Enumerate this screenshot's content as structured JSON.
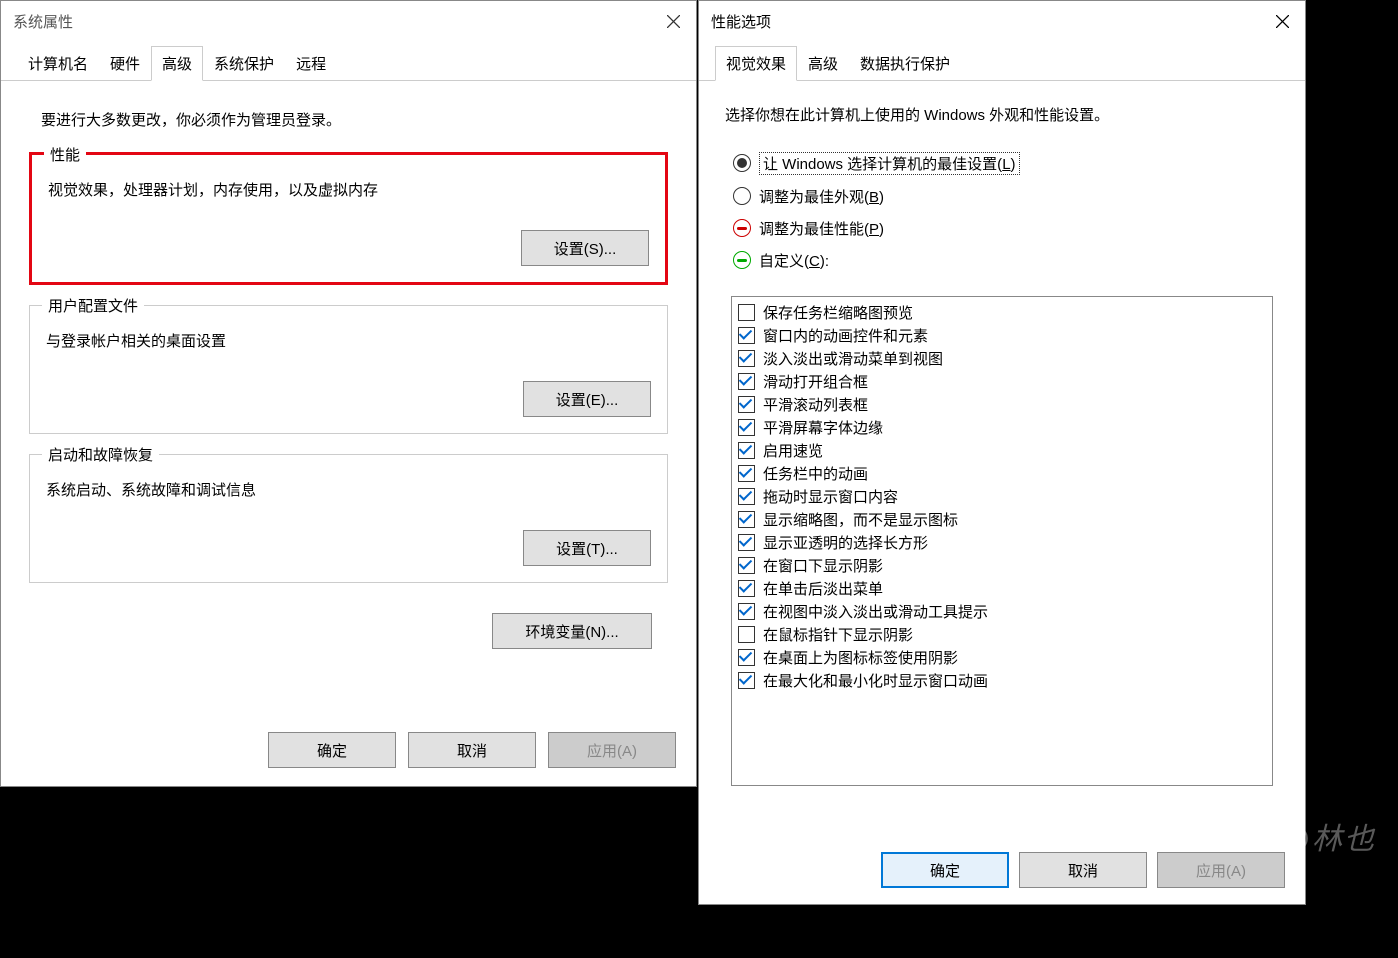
{
  "sysprop": {
    "title": "系统属性",
    "tabs": [
      "计算机名",
      "硬件",
      "高级",
      "系统保护",
      "远程"
    ],
    "active_tab": 2,
    "admin_note": "要进行大多数更改，你必须作为管理员登录。",
    "groups": {
      "perf": {
        "title": "性能",
        "desc": "视觉效果，处理器计划，内存使用，以及虚拟内存",
        "btn": "设置(S)..."
      },
      "user": {
        "title": "用户配置文件",
        "desc": "与登录帐户相关的桌面设置",
        "btn": "设置(E)..."
      },
      "boot": {
        "title": "启动和故障恢复",
        "desc": "系统启动、系统故障和调试信息",
        "btn": "设置(T)..."
      }
    },
    "envvar_btn": "环境变量(N)...",
    "footer": {
      "ok": "确定",
      "cancel": "取消",
      "apply": "应用(A)"
    }
  },
  "perfopt": {
    "title": "性能选项",
    "tabs": [
      "视觉效果",
      "高级",
      "数据执行保护"
    ],
    "active_tab": 0,
    "desc": "选择你想在此计算机上使用的 Windows 外观和性能设置。",
    "radios": [
      {
        "pre": "让 Windows 选择计算机的最佳设置(",
        "hot": "L",
        "post": ")",
        "state": "selected",
        "dotted": true
      },
      {
        "pre": "调整为最佳外观(",
        "hot": "B",
        "post": ")",
        "state": ""
      },
      {
        "pre": "调整为最佳性能(",
        "hot": "P",
        "post": ")",
        "state": "red"
      },
      {
        "pre": "自定义(",
        "hot": "C",
        "post": "):",
        "state": "green"
      }
    ],
    "checks": [
      {
        "on": false,
        "label": "保存任务栏缩略图预览"
      },
      {
        "on": true,
        "label": "窗口内的动画控件和元素"
      },
      {
        "on": true,
        "label": "淡入淡出或滑动菜单到视图"
      },
      {
        "on": true,
        "label": "滑动打开组合框"
      },
      {
        "on": true,
        "label": "平滑滚动列表框"
      },
      {
        "on": true,
        "label": "平滑屏幕字体边缘"
      },
      {
        "on": true,
        "label": "启用速览"
      },
      {
        "on": true,
        "label": "任务栏中的动画"
      },
      {
        "on": true,
        "label": "拖动时显示窗口内容"
      },
      {
        "on": true,
        "label": "显示缩略图，而不是显示图标"
      },
      {
        "on": true,
        "label": "显示亚透明的选择长方形"
      },
      {
        "on": true,
        "label": "在窗口下显示阴影"
      },
      {
        "on": true,
        "label": "在单击后淡出菜单"
      },
      {
        "on": true,
        "label": "在视图中淡入淡出或滑动工具提示"
      },
      {
        "on": false,
        "label": "在鼠标指针下显示阴影"
      },
      {
        "on": true,
        "label": "在桌面上为图标标签使用阴影"
      },
      {
        "on": true,
        "label": "在最大化和最小化时显示窗口动画"
      }
    ],
    "footer": {
      "ok": "确定",
      "cancel": "取消",
      "apply": "应用(A)"
    }
  },
  "watermark": "知乎 @林也"
}
